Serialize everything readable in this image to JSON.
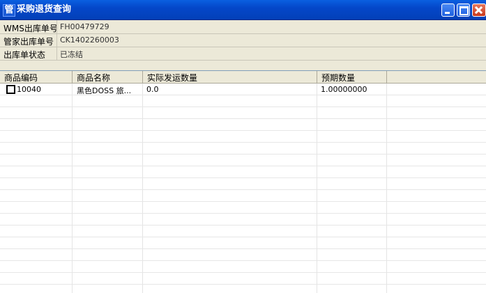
{
  "window": {
    "title": "采购退货查询",
    "app_icon_glyph": "管"
  },
  "form": {
    "fields": [
      {
        "label": "WMS出库单号",
        "value": "FH00479729"
      },
      {
        "label": "管家出库单号",
        "value": "CK1402260003"
      },
      {
        "label": "出库单状态",
        "value": "已冻结"
      }
    ]
  },
  "table": {
    "columns": [
      "商品编码",
      "商品名称",
      "实际发运数量",
      "预期数量"
    ],
    "rows": [
      {
        "checked": false,
        "code": "10040",
        "name": "黑色DOSS 旅...",
        "actual_qty": "0.0",
        "expected_qty": "1.00000000"
      }
    ]
  },
  "colors": {
    "titlebar": "#0447c9",
    "window_bg": "#ece9d8",
    "close_button": "#c8371b"
  }
}
